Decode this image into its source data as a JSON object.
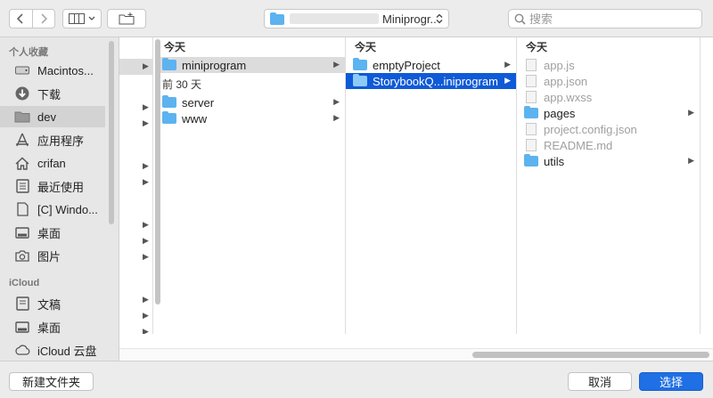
{
  "toolbar": {
    "path_label": "Miniprogr...",
    "search_placeholder": "搜索"
  },
  "sidebar": {
    "favorites_header": "个人收藏",
    "icloud_header": "iCloud",
    "favorites": [
      {
        "label": "Macintos...",
        "icon": "hard-drive-icon"
      },
      {
        "label": "下载",
        "icon": "downloads-icon"
      },
      {
        "label": "dev",
        "icon": "folder-icon",
        "selected": true
      },
      {
        "label": "应用程序",
        "icon": "applications-icon"
      },
      {
        "label": "crifan",
        "icon": "home-icon"
      },
      {
        "label": "最近使用",
        "icon": "recents-icon"
      },
      {
        "label": "[C] Windo...",
        "icon": "document-icon"
      },
      {
        "label": "桌面",
        "icon": "desktop-icon"
      },
      {
        "label": "图片",
        "icon": "camera-icon"
      }
    ],
    "icloud": [
      {
        "label": "文稿",
        "icon": "document-icon"
      },
      {
        "label": "桌面",
        "icon": "desktop-icon"
      },
      {
        "label": "iCloud 云盘",
        "icon": "cloud-icon"
      }
    ]
  },
  "columns": {
    "col1": {
      "header": "今天",
      "rows": [
        {
          "label": "miniprogram",
          "kind": "folder",
          "state": "gray"
        }
      ],
      "group2_header": "前 30 天",
      "rows2": [
        {
          "label": "server",
          "kind": "folder"
        },
        {
          "label": "www",
          "kind": "folder"
        }
      ]
    },
    "col2": {
      "header": "今天",
      "rows": [
        {
          "label": "emptyProject",
          "kind": "folder"
        },
        {
          "label": "StorybookQ...iniprogram",
          "kind": "folder",
          "state": "blue"
        }
      ]
    },
    "col3": {
      "header": "今天",
      "rows": [
        {
          "label": "app.js",
          "kind": "file",
          "dim": true
        },
        {
          "label": "app.json",
          "kind": "file",
          "dim": true
        },
        {
          "label": "app.wxss",
          "kind": "file",
          "dim": true
        },
        {
          "label": "pages",
          "kind": "folder"
        },
        {
          "label": "project.config.json",
          "kind": "file",
          "dim": true
        },
        {
          "label": "README.md",
          "kind": "file",
          "dim": true
        },
        {
          "label": "utils",
          "kind": "folder"
        }
      ]
    }
  },
  "footer": {
    "new_folder_label": "新建文件夹",
    "cancel_label": "取消",
    "choose_label": "选择"
  }
}
